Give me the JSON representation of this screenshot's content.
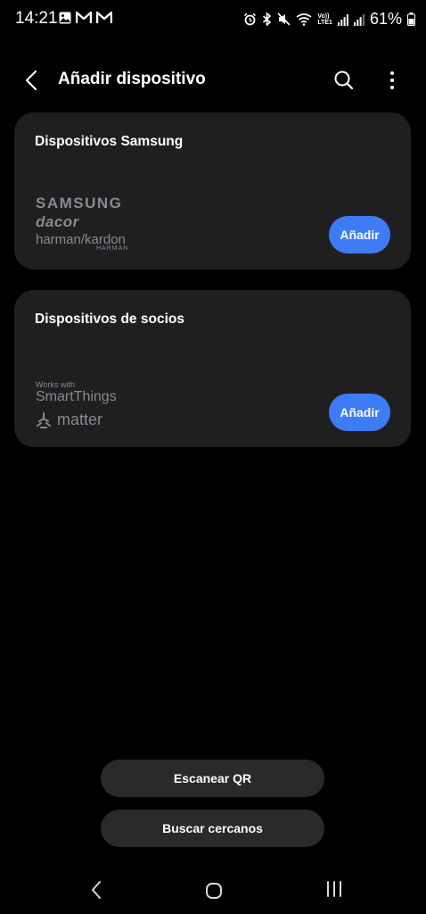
{
  "status_bar": {
    "time": "14:21",
    "battery": "61%",
    "left_icons": [
      "gallery-icon",
      "gmail-icon",
      "gmail-icon"
    ],
    "right_icons": [
      "alarm-icon",
      "bluetooth-icon",
      "mute-icon",
      "wifi-icon",
      "volte-icon",
      "signal-icon",
      "signal-icon",
      "battery-icon"
    ],
    "network_label_top": "Vo))",
    "network_label_bottom": "LTE1"
  },
  "app_bar": {
    "title": "Añadir dispositivo"
  },
  "cards": {
    "samsung": {
      "title": "Dispositivos Samsung",
      "logos": {
        "samsung": "SAMSUNG",
        "dacor": "dacor",
        "harman": "harman/kardon",
        "harman_sub": "HARMAN"
      },
      "button": "Añadir"
    },
    "partners": {
      "title": "Dispositivos de socios",
      "logos": {
        "works_with": "Works with",
        "smartthings": "SmartThings",
        "matter": "matter"
      },
      "button": "Añadir"
    }
  },
  "bottom_buttons": {
    "scan_qr": "Escanear QR",
    "search_nearby": "Buscar cercanos"
  },
  "colors": {
    "background": "#000000",
    "card": "#1f1f22",
    "accent": "#3d7bf7",
    "secondary_button": "#2a2a2d",
    "logo_gray": "#8a8a8e"
  }
}
